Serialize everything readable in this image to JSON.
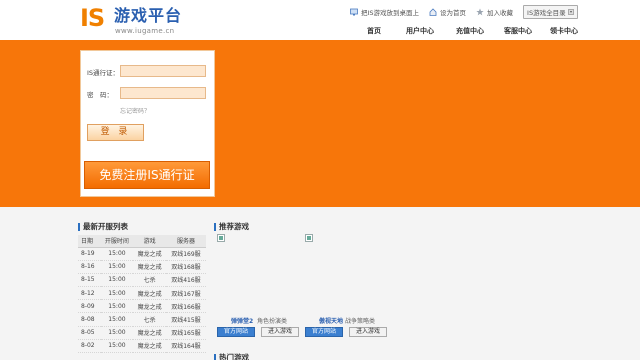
{
  "logo": {
    "main": "IS",
    "name": "游戏平台",
    "url": "www.iugame.cn"
  },
  "toplinks": [
    {
      "label": "把IS游戏放到桌面上",
      "icon": "desktop-icon"
    },
    {
      "label": "设为首页",
      "icon": "home-icon"
    },
    {
      "label": "加入收藏",
      "icon": "star-icon"
    }
  ],
  "allgames_label": "IS游戏全目录",
  "nav": [
    "首页",
    "用户中心",
    "充值中心",
    "客服中心",
    "领卡中心"
  ],
  "login": {
    "account_label": "IS通行证：",
    "password_label": "密　码：",
    "account_value": "",
    "password_value": "",
    "forgot": "忘记密码？",
    "login_button": "登 录",
    "register_button": "免费注册IS通行证"
  },
  "servers": {
    "title": "最新开服列表",
    "columns": [
      "日期",
      "开服时间",
      "游戏",
      "服务器"
    ],
    "rows": [
      [
        "8-19",
        "15:00",
        "魔龙之戒",
        "双线169服"
      ],
      [
        "8-16",
        "15:00",
        "魔龙之戒",
        "双线168服"
      ],
      [
        "8-15",
        "15:00",
        "七杀",
        "双线416服"
      ],
      [
        "8-12",
        "15:00",
        "魔龙之戒",
        "双线167服"
      ],
      [
        "8-09",
        "15:00",
        "魔龙之戒",
        "双线166服"
      ],
      [
        "8-08",
        "15:00",
        "七杀",
        "双线415服"
      ],
      [
        "8-05",
        "15:00",
        "魔龙之戒",
        "双线165服"
      ],
      [
        "8-02",
        "15:00",
        "魔龙之戒",
        "双线164服"
      ]
    ]
  },
  "recommended": {
    "title": "推荐游戏",
    "games": [
      {
        "name": "弹弹堂2",
        "type": "角色扮演类",
        "official": "官方网站",
        "enter": "进入游戏"
      },
      {
        "name": "傲视天地",
        "type": "战争策略类",
        "official": "官方网站",
        "enter": "进入游戏"
      }
    ]
  },
  "hot": {
    "title": "热门游戏"
  },
  "colors": {
    "brand_orange": "#f7760a",
    "brand_blue": "#2a5fb0"
  }
}
